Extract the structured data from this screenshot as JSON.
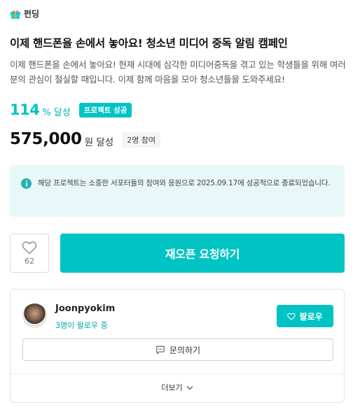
{
  "category": {
    "icon": "gift-icon",
    "label": "펀딩"
  },
  "project": {
    "title": "이제 핸드폰을 손에서 놓아요! 청소년 미디어 중독 알림 캠페인",
    "summary": "이제 핸드폰을 손에서 놓아요! 현재 시대에 심각한 미디어중독을 겪고 있는 학생들을 위해 여러분의 관심이 절실할 때입니다. 이제 함께 마음을 모아 청소년들을 도와주세요!"
  },
  "progress": {
    "rate": "114",
    "rate_unit": "% 달성",
    "rate_value": 1.14,
    "status_badge": "프로젝트 성공"
  },
  "funding": {
    "amount": "575,000",
    "amount_unit": "원 달성",
    "participants": "2명 참여"
  },
  "notice": {
    "icon": "info-icon",
    "text": "해당 프로젝트는 소중한 서포터들의 참여와 응원으로 2025.09.17에 성공적으로 종료되었습니다."
  },
  "actions": {
    "like_icon": "heart-outline-icon",
    "like_count": "62",
    "main_label": "재오픈 요청하기"
  },
  "maker": {
    "name": "Joonpyokim",
    "followers_text": "3명이 팔로우 중",
    "follow_label": "팔로우",
    "inquiry_label": "문의하기",
    "more_label": "더보기"
  },
  "colors": {
    "accent": "#00c4c4",
    "notice_bg": "#e8f7f7",
    "text_primary": "#111111"
  }
}
